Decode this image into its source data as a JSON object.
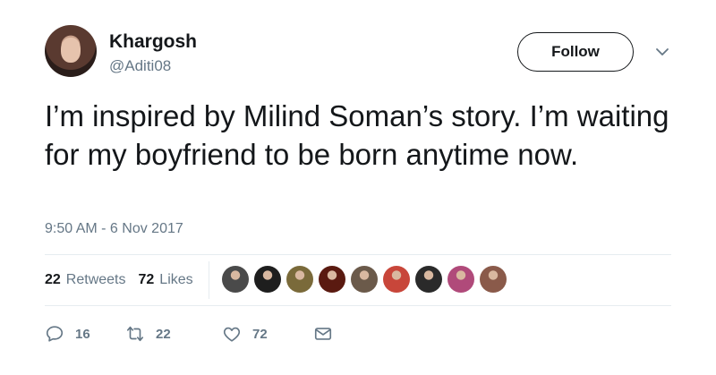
{
  "author": {
    "name": "Khargosh",
    "handle": "@Aditi08"
  },
  "follow_label": "Follow",
  "tweet": {
    "text": "I’m inspired by Milind Soman’s story. I’m waiting for my boyfriend to be born anytime now.",
    "timestamp": "9:50 AM - 6 Nov 2017"
  },
  "stats": {
    "retweets_count": "22",
    "retweets_label": "Retweets",
    "likes_count": "72",
    "likes_label": "Likes"
  },
  "likers": [
    {
      "color": "#4a4a4a"
    },
    {
      "color": "#1e1e1e"
    },
    {
      "color": "#7a6a3a"
    },
    {
      "color": "#5a1a10"
    },
    {
      "color": "#6b5a4a"
    },
    {
      "color": "#c8463a"
    },
    {
      "color": "#2a2a2a"
    },
    {
      "color": "#b04a7a"
    },
    {
      "color": "#8a5a4a"
    }
  ],
  "actions": {
    "reply_count": "16",
    "retweet_count": "22",
    "like_count": "72"
  },
  "icons": {
    "caret": "chevron-down-icon",
    "reply": "reply-icon",
    "retweet": "retweet-icon",
    "like": "heart-icon",
    "dm": "envelope-icon"
  }
}
